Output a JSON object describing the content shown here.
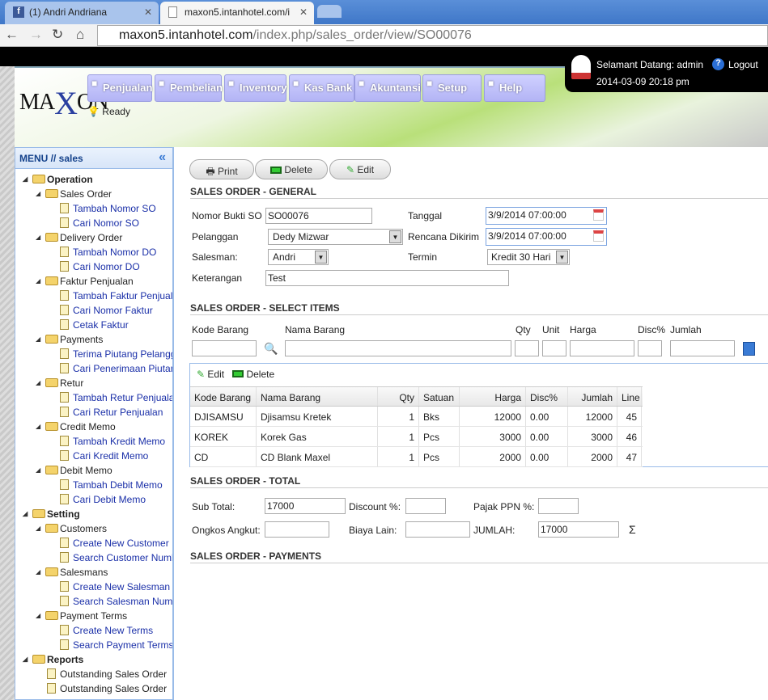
{
  "browser": {
    "tabs": [
      {
        "label": "(1) Andri Andriana",
        "icon": "facebook-icon"
      },
      {
        "label": "maxon5.intanhotel.com/i",
        "icon": "page-icon"
      }
    ],
    "url_host": "maxon5.intanhotel.com",
    "url_path": "/index.php/sales_order/view/SO00076"
  },
  "header": {
    "logo": "MAXON",
    "status": "Ready",
    "welcome": "Selamant Datang: admin",
    "logout": "Logout",
    "datetime": "2014-03-09 20:18 pm",
    "menu": [
      {
        "label": "Penjualan",
        "icon": "chat-icon"
      },
      {
        "label": "Pembelian",
        "icon": "phone-icon"
      },
      {
        "label": "Inventory",
        "icon": "building-icon"
      },
      {
        "label": "Kas Bank",
        "icon": "mail-icon"
      },
      {
        "label": "Akuntansi",
        "icon": "book-icon"
      },
      {
        "label": "Setup",
        "icon": "monitor-icon"
      },
      {
        "label": "Help",
        "icon": "bulb-icon"
      }
    ]
  },
  "sidebar": {
    "title": "MENU // sales",
    "items": [
      {
        "label": "Operation",
        "type": "root"
      },
      {
        "label": "Sales Order",
        "type": "folder"
      },
      {
        "label": "Tambah Nomor SO",
        "type": "leaf"
      },
      {
        "label": "Cari Nomor SO",
        "type": "leaf"
      },
      {
        "label": "Delivery Order",
        "type": "folder"
      },
      {
        "label": "Tambah Nomor DO",
        "type": "leaf"
      },
      {
        "label": "Cari Nomor DO",
        "type": "leaf"
      },
      {
        "label": "Faktur Penjualan",
        "type": "folder"
      },
      {
        "label": "Tambah Faktur Penjualan",
        "type": "leaf"
      },
      {
        "label": "Cari Nomor Faktur",
        "type": "leaf"
      },
      {
        "label": "Cetak Faktur",
        "type": "leaf"
      },
      {
        "label": "Payments",
        "type": "folder"
      },
      {
        "label": "Terima Piutang Pelanggan",
        "type": "leaf"
      },
      {
        "label": "Cari Penerimaan Piutang",
        "type": "leaf"
      },
      {
        "label": "Retur",
        "type": "folder"
      },
      {
        "label": "Tambah Retur Penjualan",
        "type": "leaf"
      },
      {
        "label": "Cari Retur Penjualan",
        "type": "leaf"
      },
      {
        "label": "Credit Memo",
        "type": "folder"
      },
      {
        "label": "Tambah Kredit Memo",
        "type": "leaf"
      },
      {
        "label": "Cari Kredit Memo",
        "type": "leaf"
      },
      {
        "label": "Debit Memo",
        "type": "folder"
      },
      {
        "label": "Tambah Debit Memo",
        "type": "leaf"
      },
      {
        "label": "Cari Debit Memo",
        "type": "leaf"
      },
      {
        "label": "Setting",
        "type": "root"
      },
      {
        "label": "Customers",
        "type": "folder"
      },
      {
        "label": "Create New Customer",
        "type": "leaf"
      },
      {
        "label": "Search Customer Number",
        "type": "leaf"
      },
      {
        "label": "Salesmans",
        "type": "folder"
      },
      {
        "label": "Create New Salesman",
        "type": "leaf"
      },
      {
        "label": "Search Salesman Number",
        "type": "leaf"
      },
      {
        "label": "Payment Terms",
        "type": "folder"
      },
      {
        "label": "Create New Terms",
        "type": "leaf"
      },
      {
        "label": "Search Payment Terms",
        "type": "leaf"
      },
      {
        "label": "Reports",
        "type": "root"
      },
      {
        "label": "Outstanding Sales Order",
        "type": "rleaf"
      },
      {
        "label": "Outstanding Sales Order",
        "type": "rleaf"
      }
    ]
  },
  "toolbar": {
    "print": "Print",
    "delete": "Delete",
    "edit": "Edit"
  },
  "general": {
    "title": "SALES ORDER - GENERAL",
    "nomor_label": "Nomor Bukti SO",
    "nomor": "SO00076",
    "tanggal_label": "Tanggal",
    "tanggal": "3/9/2014 07:00:00",
    "pelanggan_label": "Pelanggan",
    "pelanggan": "Dedy Mizwar",
    "rencana_label": "Rencana Dikirim",
    "rencana": "3/9/2014 07:00:00",
    "salesman_label": "Salesman:",
    "salesman": "Andri",
    "termin_label": "Termin",
    "termin": "Kredit 30 Hari",
    "keterangan_label": "Keterangan",
    "keterangan": "Test"
  },
  "items": {
    "title": "SALES ORDER - SELECT ITEMS",
    "kode": "Kode Barang",
    "nama": "Nama Barang",
    "qty": "Qty",
    "unit": "Unit",
    "harga": "Harga",
    "disc": "Disc%",
    "jumlah": "Jumlah"
  },
  "grid": {
    "edit": "Edit",
    "delete": "Delete",
    "columns": [
      "Kode Barang",
      "Nama Barang",
      "Qty",
      "Satuan",
      "Harga",
      "Disc%",
      "Jumlah",
      "Line"
    ],
    "rows": [
      [
        "DJISAMSU",
        "Djisamsu Kretek",
        "1",
        "Bks",
        "12000",
        "0.00",
        "12000",
        "45"
      ],
      [
        "KOREK",
        "Korek Gas",
        "1",
        "Pcs",
        "3000",
        "0.00",
        "3000",
        "46"
      ],
      [
        "CD",
        "CD Blank Maxel",
        "1",
        "Pcs",
        "2000",
        "0.00",
        "2000",
        "47"
      ]
    ]
  },
  "total": {
    "title": "SALES ORDER - TOTAL",
    "subtotal_label": "Sub Total:",
    "subtotal": "17000",
    "discount_label": "Discount %:",
    "discount": "",
    "pajak_label": "Pajak PPN %:",
    "pajak": "",
    "ongkos_label": "Ongkos Angkut:",
    "ongkos": "",
    "biaya_label": "Biaya Lain:",
    "biaya": "",
    "jumlah_label": "JUMLAH:",
    "jumlah": "17000",
    "sigma": "Σ"
  },
  "payments": {
    "title": "SALES ORDER - PAYMENTS"
  }
}
